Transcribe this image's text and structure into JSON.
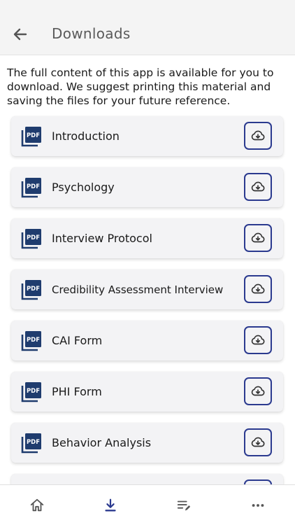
{
  "header": {
    "title": "Downloads",
    "back_icon": "arrow-left-icon"
  },
  "intro_text": "The full content of this app is available for you to download.  We suggest printing this material and saving the files for your future reference.",
  "downloads": [
    {
      "label": "Introduction",
      "icon": "pdf-icon",
      "action_icon": "cloud-download-icon"
    },
    {
      "label": "Psychology",
      "icon": "pdf-icon",
      "action_icon": "cloud-download-icon"
    },
    {
      "label": "Interview Protocol",
      "icon": "pdf-icon",
      "action_icon": "cloud-download-icon"
    },
    {
      "label": "Credibility Assessment Interview",
      "icon": "pdf-icon",
      "action_icon": "cloud-download-icon"
    },
    {
      "label": "CAI Form",
      "icon": "pdf-icon",
      "action_icon": "cloud-download-icon"
    },
    {
      "label": "PHI Form",
      "icon": "pdf-icon",
      "action_icon": "cloud-download-icon"
    },
    {
      "label": "Behavior Analysis",
      "icon": "pdf-icon",
      "action_icon": "cloud-download-icon"
    }
  ],
  "pdf_badge_text": "PDF",
  "bottom_nav": [
    {
      "icon": "home-icon",
      "active": false
    },
    {
      "icon": "download-icon",
      "active": true
    },
    {
      "icon": "notes-edit-icon",
      "active": false
    },
    {
      "icon": "more-horizontal-icon",
      "active": false
    }
  ],
  "colors": {
    "accent": "#2b3a8f",
    "pdf_icon": "#1f3c6e",
    "header_bg": "#f4f4f4",
    "card_bg": "#f3f3f5",
    "nav_icon": "#555555"
  }
}
